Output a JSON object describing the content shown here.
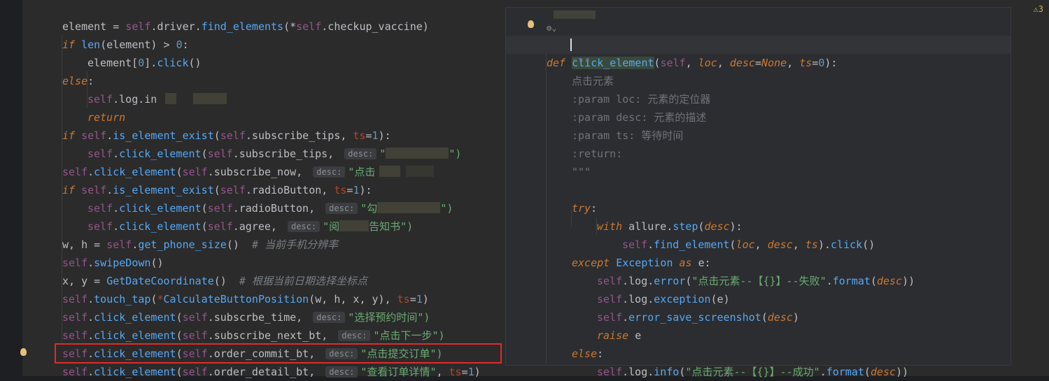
{
  "status": {
    "warning_count": "3",
    "warning_icon": "warning-triangle-icon"
  },
  "left_code": {
    "l00_a": "element = ",
    "l00_b": "self",
    "l00_c": ".driver.",
    "l00_d": "find_elements",
    "l00_e": "(*",
    "l00_f": "self",
    "l00_g": ".checkup_vaccine)",
    "l01_kw": "if ",
    "l01_fn": "len",
    "l01_a": "(element) > ",
    "l01_num": "0",
    "l01_b": ":",
    "l02_a": "element[",
    "l02_num": "0",
    "l02_b": "].",
    "l02_fn": "click",
    "l02_c": "()",
    "l03_kw": "else",
    "l03_b": ":",
    "l04_self": "self",
    "l04_a": ".log.in",
    "l05_kw": "return",
    "l06_kw": "if ",
    "l06_self": "self",
    "l06_a": ".",
    "l06_fn": "is_element_exist",
    "l06_b": "(",
    "l06_self2": "self",
    "l06_c": ".subscribe_tips, ",
    "l06_kw2": "ts",
    "l06_eq": "=",
    "l06_num": "1",
    "l06_d": "):",
    "l07_self": "self",
    "l07_a": ".",
    "l07_fn": "click_element",
    "l07_b": "(",
    "l07_self2": "self",
    "l07_c": ".subscribe_tips, ",
    "l07_hint": "desc:",
    "l07_str1": "\"",
    "l07_str2": "\")",
    "l08_self": "self",
    "l08_a": ".",
    "l08_fn": "click_element",
    "l08_b": "(",
    "l08_self2": "self",
    "l08_c": ".subscribe_now, ",
    "l08_hint": "desc:",
    "l08_str": "\"点击",
    "l09_kw": "if ",
    "l09_self": "self",
    "l09_a": ".",
    "l09_fn": "is_element_exist",
    "l09_b": "(",
    "l09_self2": "self",
    "l09_c": ".radioButton, ",
    "l09_kw2": "ts",
    "l09_eq": "=",
    "l09_num": "1",
    "l09_d": "):",
    "l10_self": "self",
    "l10_a": ".",
    "l10_fn": "click_element",
    "l10_b": "(",
    "l10_self2": "self",
    "l10_c": ".radioButton, ",
    "l10_hint": "desc:",
    "l10_str1": "\"勾",
    "l10_str2": "\")",
    "l11_self": "self",
    "l11_a": ".",
    "l11_fn": "click_element",
    "l11_b": "(",
    "l11_self2": "self",
    "l11_c": ".agree, ",
    "l11_hint": "desc:",
    "l11_str1": "\"阅",
    "l11_str2": "告知书\")",
    "l12_a": "w, h = ",
    "l12_self": "self",
    "l12_b": ".",
    "l12_fn": "get_phone_size",
    "l12_c": "()  ",
    "l12_cmt": "# 当前手机分辨率",
    "l13_self": "self",
    "l13_a": ".",
    "l13_fn": "swipeDown",
    "l13_b": "()",
    "l14_a": "x, y = ",
    "l14_fn": "GetDateCoordinate",
    "l14_b": "()  ",
    "l14_cmt": "# 根据当前日期选择坐标点",
    "l15_self": "self",
    "l15_a": ".",
    "l15_fn": "touch_tap",
    "l15_b": "(",
    "l15_star": "*",
    "l15_fn2": "CalculateButtonPosition",
    "l15_c": "(w, h, x, y), ",
    "l15_kw2": "ts",
    "l15_eq": "=",
    "l15_num": "1",
    "l15_d": ")",
    "l16_self": "self",
    "l16_a": ".",
    "l16_fn": "click_element",
    "l16_b": "(",
    "l16_self2": "self",
    "l16_c": ".subscrbe_time, ",
    "l16_hint": "desc:",
    "l16_str": "\"选择预约时间\")",
    "l17_self": "self",
    "l17_a": ".",
    "l17_fn": "click_element",
    "l17_b": "(",
    "l17_self2": "self",
    "l17_c": ".subscribe_next_bt, ",
    "l17_hint": "desc:",
    "l17_str": "\"点击下一步\")",
    "l18_self": "self",
    "l18_a": ".",
    "l18_fn": "click_element",
    "l18_b": "(",
    "l18_self2": "self",
    "l18_c": ".order_commit_bt, ",
    "l18_hint": "desc:",
    "l18_str": "\"点击提交订单\")",
    "l19_self": "self",
    "l19_a": ".",
    "l19_fn": "click_element",
    "l19_b": "(",
    "l19_self2": "self",
    "l19_c": ".order_detail_bt, ",
    "l19_hint": "desc:",
    "l19_str": "\"查看订单详情\"",
    "l19_d": ", ",
    "l19_kw2": "ts",
    "l19_eq": "=",
    "l19_num": "1",
    "l19_e": ")"
  },
  "popup": {
    "def_kw": "def ",
    "def_name": "click_element",
    "def_a": "(",
    "def_self": "self",
    "def_b": ", ",
    "def_loc": "loc",
    "def_c": ", ",
    "def_desc": "desc",
    "def_eq1": "=",
    "def_none": "None",
    "def_d": ", ",
    "def_ts": "ts",
    "def_eq2": "=",
    "def_zero": "0",
    "def_e": "):",
    "doc_open": "\"\"\"",
    "doc_1": "点击元素",
    "doc_2": ":param loc: 元素的定位器",
    "doc_3": ":param desc: 元素的描述",
    "doc_4": ":param ts: 等待时间",
    "doc_5": ":return:",
    "doc_close": "\"\"\"",
    "try_kw": "try",
    "try_b": ":",
    "with_kw": "with ",
    "with_a": "allure.",
    "with_fn": "step",
    "with_b": "(",
    "with_desc": "desc",
    "with_c": "):",
    "find_self": "self",
    "find_a": ".",
    "find_fn": "find_element",
    "find_b": "(",
    "find_loc": "loc",
    "find_c": ", ",
    "find_desc": "desc",
    "find_d": ", ",
    "find_ts": "ts",
    "find_e": ").",
    "find_fn2": "click",
    "find_f": "()",
    "except_kw": "except ",
    "except_a": "Exception ",
    "except_as": "as ",
    "except_b": "e:",
    "err_self": "self",
    "err_a": ".log.",
    "err_fn": "error",
    "err_b": "(",
    "err_str": "\"点击元素--【{}】--失败\"",
    "err_c": ".",
    "err_fn2": "format",
    "err_d": "(",
    "err_desc": "desc",
    "err_e": "))",
    "exc_self": "self",
    "exc_a": ".log.",
    "exc_fn": "exception",
    "exc_b": "(e)",
    "ss_self": "self",
    "ss_a": ".",
    "ss_fn": "error_save_screenshot",
    "ss_b": "(",
    "ss_desc": "desc",
    "ss_c": ")",
    "raise_kw": "raise ",
    "raise_a": "e",
    "else_kw": "else",
    "else_b": ":",
    "info_self": "self",
    "info_a": ".log.",
    "info_fn": "info",
    "info_b": "(",
    "info_str": "\"点击元素--【{}】--成功\"",
    "info_c": ".",
    "info_fn2": "format",
    "info_d": "(",
    "info_desc": "desc",
    "info_e": "))"
  }
}
